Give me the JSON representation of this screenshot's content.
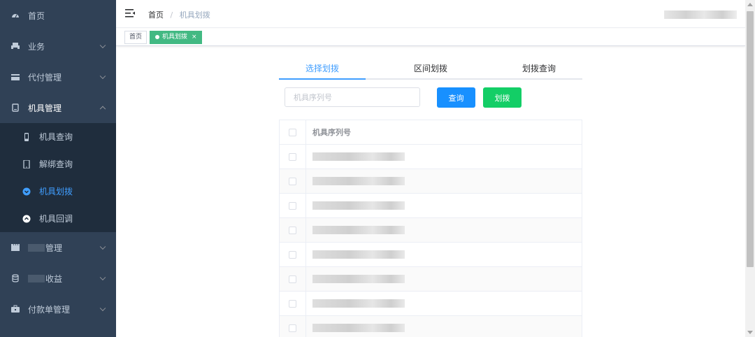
{
  "sidebar": {
    "items": [
      {
        "label": "首页",
        "icon": "dashboard-icon"
      },
      {
        "label": "业务",
        "icon": "printer-icon"
      },
      {
        "label": "代付管理",
        "icon": "wallet-icon"
      },
      {
        "label": "机具管理",
        "icon": "device-icon"
      },
      {
        "label": "管理",
        "icon": "clapper-icon"
      },
      {
        "label": "收益",
        "icon": "database-icon"
      },
      {
        "label": "付款单管理",
        "icon": "briefcase-icon"
      }
    ],
    "submenu": [
      {
        "label": "机具查询",
        "icon": "phone-icon"
      },
      {
        "label": "解绑查询",
        "icon": "tablet-icon"
      },
      {
        "label": "机具划拨",
        "icon": "circle-down-icon"
      },
      {
        "label": "机具回调",
        "icon": "circle-up-icon"
      }
    ]
  },
  "breadcrumb": {
    "home": "首页",
    "separator": "/",
    "current": "机具划拨"
  },
  "tags": {
    "home": "首页",
    "active": "机具划拨",
    "close": "×"
  },
  "tabs": [
    "选择划拨",
    "区间划拨",
    "划拨查询"
  ],
  "search": {
    "placeholder": "机具序列号"
  },
  "buttons": {
    "query": "查询",
    "transfer": "划拨"
  },
  "table": {
    "header": "机具序列号",
    "row_count": 8
  },
  "colors": {
    "sidebar_bg": "#304156",
    "submenu_bg": "#1f2d3d",
    "accent": "#409eff",
    "tag_active": "#42b983",
    "btn_query": "#1890ff",
    "btn_transfer": "#13ce66"
  }
}
